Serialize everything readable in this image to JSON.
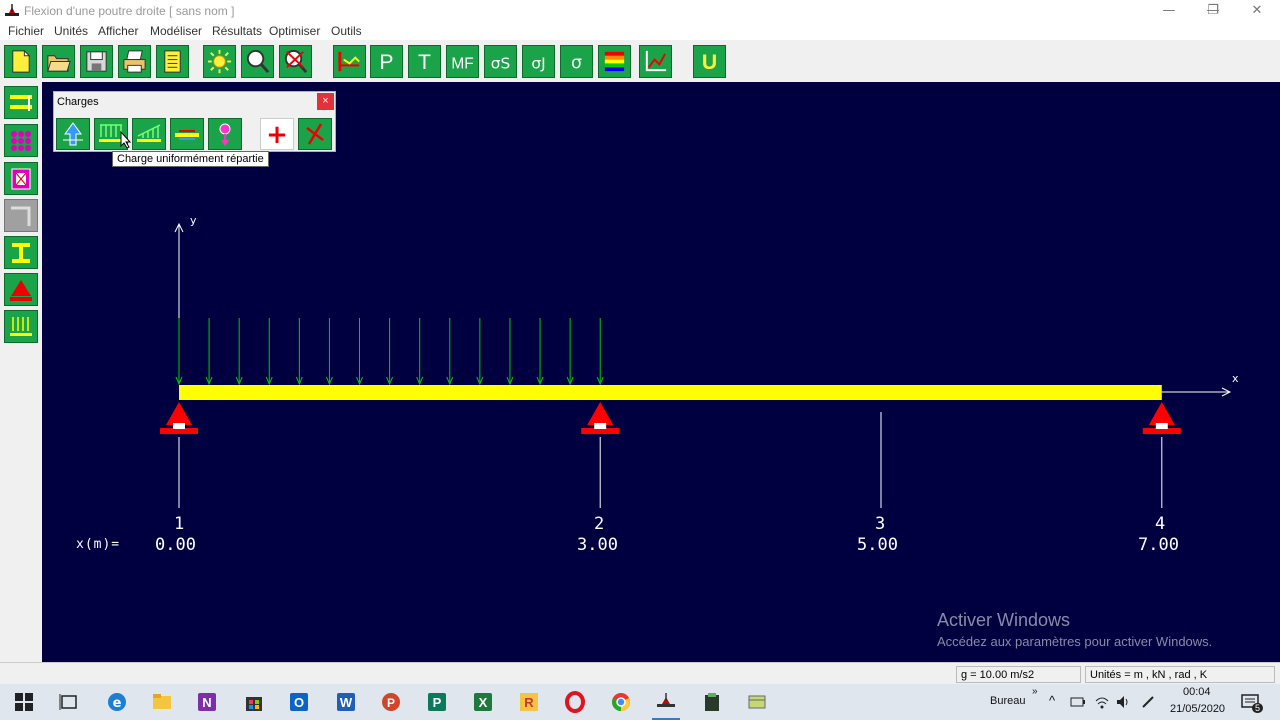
{
  "window": {
    "title": "Flexion d'une poutre droite    [ sans nom ]",
    "minimize": "—",
    "restore": "❐",
    "close": "✕"
  },
  "menu": [
    "Fichier",
    "Unités",
    "Afficher",
    "Modéliser",
    "Résultats",
    "Optimiser",
    "Outils"
  ],
  "toolbar_icons": [
    "new-file-icon",
    "open-folder-icon",
    "save-icon",
    "print-icon",
    "notes-icon",
    "sun-icon",
    "zoom-icon",
    "zoom-out-icon",
    "beam-section-icon",
    "P",
    "T",
    "MF",
    "σS",
    "σJ",
    "σ",
    "color-scale-icon",
    "axes-icon",
    "U"
  ],
  "toolbar_text": {
    "p": "P",
    "t": "T",
    "mf": "MF",
    "ss": "σS",
    "sj": "σJ",
    "s": "σ",
    "u": "U"
  },
  "left_tools": [
    "nodes-icon",
    "material-icon",
    "section-icon",
    "frame-icon",
    "i-beam-icon",
    "support-icon",
    "loads-icon"
  ],
  "charges_panel": {
    "title": "Charges",
    "close": "×",
    "tooltip": "Charge uniformément répartie",
    "add_symbol": "+"
  },
  "beam": {
    "axis_y": "y",
    "axis_x": "x",
    "x_label": "x(m)=",
    "nodes": [
      {
        "num": "1",
        "x": "0.00"
      },
      {
        "num": "2",
        "x": "3.00"
      },
      {
        "num": "3",
        "x": "5.00"
      },
      {
        "num": "4",
        "x": "7.00"
      }
    ],
    "colors": {
      "background": "#000040",
      "beam": "#ffff00",
      "load": "#00cc00",
      "support": "#ff0000"
    }
  },
  "watermark": {
    "line1": "Activer Windows",
    "line2": "Accédez aux paramètres pour activer Windows."
  },
  "status": {
    "gravity": "g = 10.00 m/s2",
    "units": "Unités = m , kN , rad , K"
  },
  "taskbar": {
    "desktop_label": "Bureau",
    "time": "00:04",
    "date": "21/05/2020",
    "notification_count": "5"
  }
}
